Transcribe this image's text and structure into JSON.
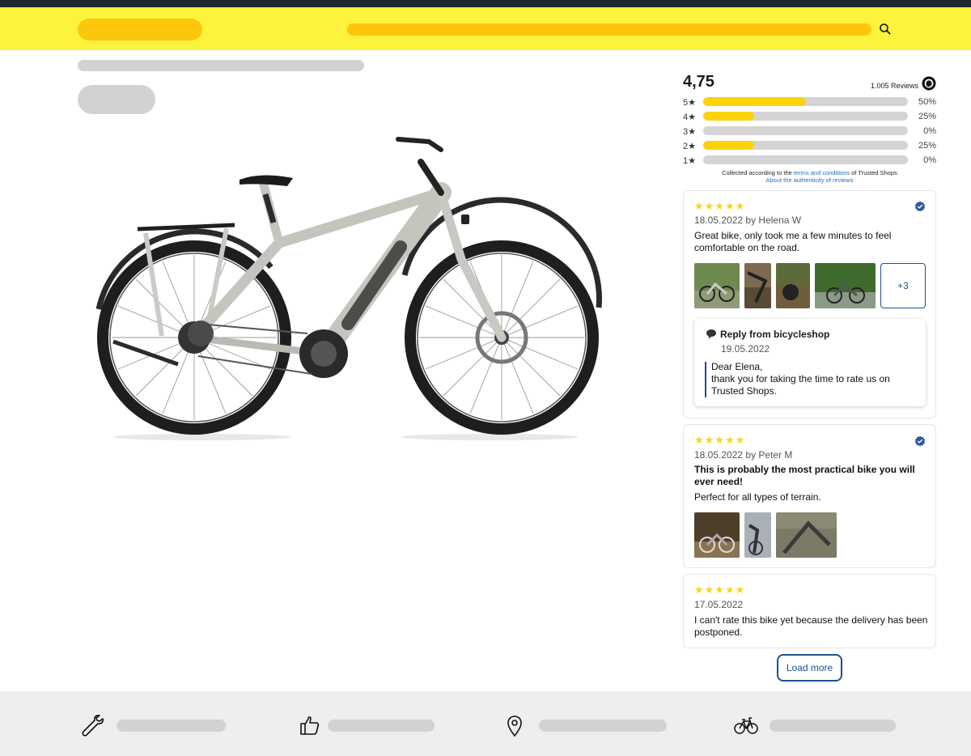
{
  "ratings": {
    "average": "4,75",
    "count": "1.005 Reviews",
    "bars": [
      {
        "label": "5★",
        "percent": "50%",
        "value": 50
      },
      {
        "label": "4★",
        "percent": "25%",
        "value": 25
      },
      {
        "label": "3★",
        "percent": "0%",
        "value": 0
      },
      {
        "label": "2★",
        "percent": "25%",
        "value": 25
      },
      {
        "label": "1★",
        "percent": "0%",
        "value": 0
      }
    ],
    "collected_prefix": "Collected according to the ",
    "collected_link": "terms and conditions",
    "collected_suffix": " of Trusted Shops",
    "authenticity_link": "About the authenticity of reviews"
  },
  "reviews": [
    {
      "stars": "★★★★★",
      "meta": "18.05.2022 by Helena W",
      "text": "Great bike, only took me a few minutes to feel comfortable on the road.",
      "more_photos": "+3",
      "reply": {
        "header": "Reply from bicycleshop",
        "date": "19.05.2022",
        "text_line1": "Dear Elena,",
        "text_line2": "thank you for taking the time to rate us on Trusted Shops."
      }
    },
    {
      "stars": "★★★★★",
      "meta": "18.05.2022 by Peter M",
      "title": "This is probably the most practical bike you will ever need!",
      "text": "Perfect for all types of terrain."
    },
    {
      "stars": "★★★★★",
      "meta": "17.05.2022",
      "text": "I can't rate this bike yet because the delivery has been postponed."
    }
  ],
  "load_more": "Load more",
  "colors": {
    "header": "#fdf23c",
    "header_placeholder": "#fdc60b",
    "star": "#fbd70b",
    "bar_fill": "#fdd20a",
    "accent": "#1f4f8f",
    "link": "#1f6fbf"
  },
  "icons": {
    "search": "search-icon",
    "trusted_shops": "trusted-shops-icon",
    "verified": "verified-badge-icon",
    "reply": "speech-bubble-icon",
    "footer": [
      "wrench-icon",
      "thumbs-up-icon",
      "location-pin-icon",
      "bicycle-icon"
    ]
  }
}
